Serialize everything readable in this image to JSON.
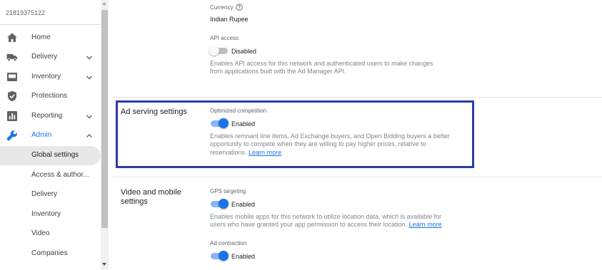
{
  "sidebar": {
    "network_id": "21819375122",
    "items": [
      {
        "label": "Home",
        "icon": "home-icon"
      },
      {
        "label": "Delivery",
        "icon": "truck-icon"
      },
      {
        "label": "Inventory",
        "icon": "inventory-icon"
      },
      {
        "label": "Protections",
        "icon": "shield-icon"
      },
      {
        "label": "Reporting",
        "icon": "bar-chart-icon"
      },
      {
        "label": "Admin",
        "icon": "wrench-icon"
      }
    ],
    "admin_subitems": [
      {
        "label": "Global settings"
      },
      {
        "label": "Access & author..."
      },
      {
        "label": "Delivery"
      },
      {
        "label": "Inventory"
      },
      {
        "label": "Video"
      },
      {
        "label": "Companies"
      }
    ]
  },
  "main": {
    "currency": {
      "label": "Currency",
      "value": "Indian Rupee"
    },
    "api_access": {
      "label": "API access",
      "state": "Disabled",
      "description": "Enables API access for this network and authenticated users to make changes from applications built with the Ad Manager API."
    },
    "ad_serving": {
      "title": "Ad serving settings",
      "optimized_competition": {
        "label": "Optimized competition",
        "state": "Enabled",
        "description": "Enables remnant line items, Ad Exchange buyers, and Open Bidding buyers a better opportunity to compete when they are willing to pay higher prices, relative to reservations.",
        "link": "Learn more"
      }
    },
    "video_mobile": {
      "title": "Video and mobile settings",
      "gps_targeting": {
        "label": "GPS targeting",
        "state": "Enabled",
        "description": "Enables mobile apps for this network to utilize location data, which is available for users who have granted your app permission to access their location.",
        "link": "Learn more"
      },
      "ad_contraction": {
        "label": "Ad contraction",
        "state": "Enabled"
      }
    }
  },
  "colors": {
    "accent": "#1a73e8",
    "highlight_border": "#2e3aa8",
    "toggle_on_track": "#8ab4f8"
  }
}
